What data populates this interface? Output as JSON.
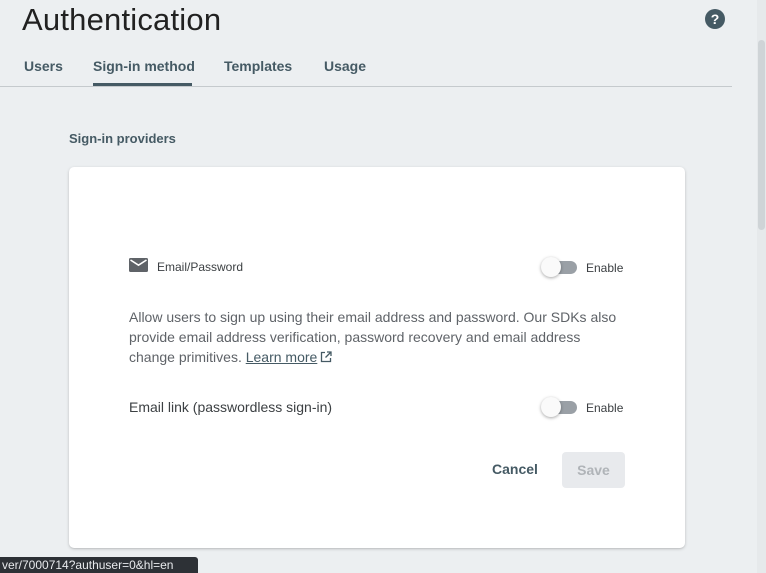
{
  "header": {
    "title": "Authentication",
    "help_icon": "help-circle-icon",
    "help_glyph": "?"
  },
  "tabs": [
    {
      "label": "Users",
      "active": false
    },
    {
      "label": "Sign-in method",
      "active": true
    },
    {
      "label": "Templates",
      "active": false
    },
    {
      "label": "Usage",
      "active": false
    }
  ],
  "section": {
    "label": "Sign-in providers"
  },
  "provider": {
    "icon": "mail-icon",
    "name": "Email/Password",
    "toggle_label": "Enable",
    "enabled": false,
    "description": "Allow users to sign up using their email address and password. Our SDKs also provide email address verification, password recovery and email address change primitives.",
    "learn_more": "Learn more",
    "learn_more_icon": "open-in-new-icon"
  },
  "email_link": {
    "label": "Email link (passwordless sign-in)",
    "toggle_label": "Enable",
    "enabled": false
  },
  "actions": {
    "cancel": "Cancel",
    "save": "Save",
    "save_disabled": true
  },
  "status_bar": {
    "url": "ver/7000714?authuser=0&hl=en"
  },
  "colors": {
    "accent": "#455a64",
    "background": "#eceff1",
    "card": "#ffffff"
  }
}
